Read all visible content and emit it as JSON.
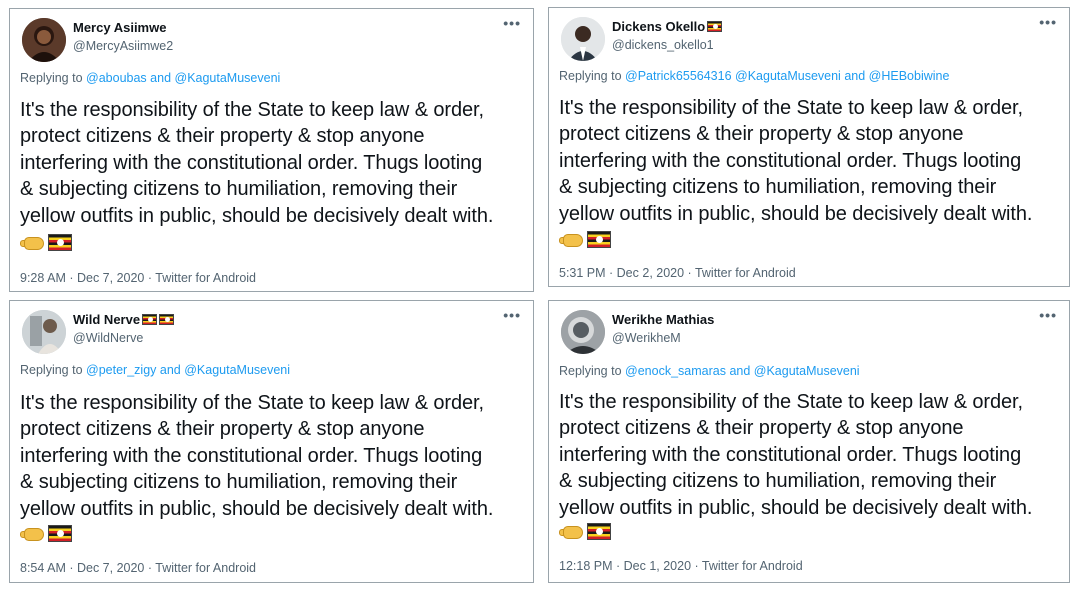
{
  "tweets": [
    {
      "name": "Mercy Asiimwe",
      "handle": "@MercyAsiimwe2",
      "name_flags": 0,
      "reply_prefix": "Replying to",
      "mentions": [
        "@aboubas",
        "@KagutaMuseveni"
      ],
      "joiners": [
        " and "
      ],
      "lines": [
        "It's the responsibility of the State to keep law & order,",
        "protect citizens & their property & stop anyone",
        "interfering with the constitutional order. Thugs looting",
        "& subjecting citizens to humiliation, removing their",
        "yellow outfits in public, should be decisively dealt with."
      ],
      "emojis": [
        "fist-icon",
        "uganda-flag-icon"
      ],
      "meta": "9:28 AM · Dec 7, 2020 · Twitter for Android",
      "avatar_color": "#3a2219"
    },
    {
      "name": "Dickens Okello",
      "handle": "@dickens_okello1",
      "name_flags": 1,
      "reply_prefix": "Replying to",
      "mentions": [
        "@Patrick65564316",
        "@KagutaMuseveni",
        "@HEBobiwine"
      ],
      "joiners": [
        " ",
        " and "
      ],
      "lines": [
        "It's the responsibility of the State to keep law & order,",
        "protect citizens & their property & stop anyone",
        "interfering with the constitutional order. Thugs looting",
        "& subjecting citizens to humiliation, removing their",
        "yellow outfits in public, should be decisively dealt with."
      ],
      "emojis": [
        "fist-icon",
        "uganda-flag-icon"
      ],
      "meta": "5:31 PM · Dec 2, 2020 · Twitter for Android",
      "avatar_color": "#d9dde0"
    },
    {
      "name": "Wild Nerve",
      "handle": "@WildNerve",
      "name_flags": 2,
      "reply_prefix": "Replying to",
      "mentions": [
        "@peter_zigy",
        "@KagutaMuseveni"
      ],
      "joiners": [
        " and "
      ],
      "lines": [
        "It's the responsibility of the State to keep law & order,",
        "protect citizens & their property & stop anyone",
        "interfering with the constitutional order. Thugs looting",
        "& subjecting citizens to humiliation, removing their",
        "yellow outfits in public, should be decisively dealt with."
      ],
      "emojis": [
        "fist-icon",
        "uganda-flag-icon"
      ],
      "meta": "8:54 AM · Dec 7, 2020 · Twitter for Android",
      "avatar_color": "#b9c2c8"
    },
    {
      "name": "Werikhe Mathias",
      "handle": "@WerikheM",
      "name_flags": 0,
      "reply_prefix": "Replying to",
      "mentions": [
        "@enock_samaras",
        "@KagutaMuseveni"
      ],
      "joiners": [
        " and "
      ],
      "lines": [
        "It's the responsibility of the State to keep law & order,",
        "protect citizens & their property & stop anyone",
        "interfering with the constitutional order. Thugs looting",
        "& subjecting citizens to humiliation, removing their",
        "yellow outfits in public, should be decisively dealt with."
      ],
      "emojis": [
        "fist-icon",
        "uganda-flag-icon"
      ],
      "meta": "12:18 PM · Dec 1, 2020 · Twitter for Android",
      "avatar_color": "#8a8f93"
    }
  ],
  "more_glyph": "•••"
}
